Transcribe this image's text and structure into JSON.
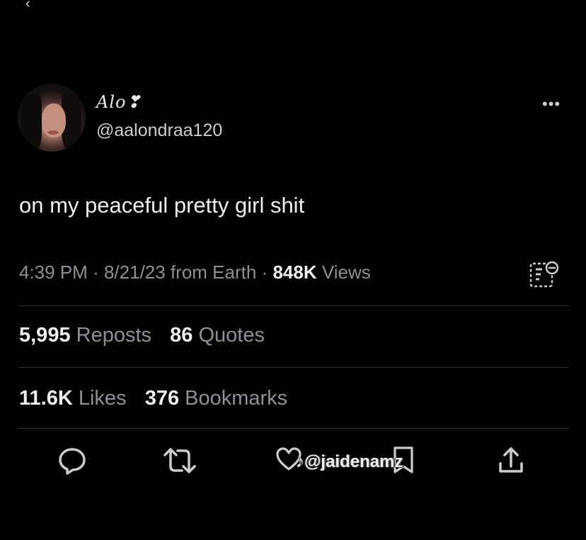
{
  "user": {
    "display_name": "Alo❣",
    "handle": "@aalondraa120"
  },
  "tweet": {
    "text": "on my peaceful pretty girl shit"
  },
  "meta": {
    "time": "4:39 PM",
    "date": "8/21/23",
    "source": "from Earth",
    "views_count": "848K",
    "views_label": "Views",
    "separator": "·"
  },
  "stats": {
    "reposts_count": "5,995",
    "reposts_label": "Reposts",
    "quotes_count": "86",
    "quotes_label": "Quotes",
    "likes_count": "11.6K",
    "likes_label": "Likes",
    "bookmarks_count": "376",
    "bookmarks_label": "Bookmarks"
  },
  "watermark": {
    "text": "@jaidenamz"
  },
  "icons": {
    "back": "back-chevron-icon",
    "more": "more-dots-icon",
    "analytics": "analytics-icon",
    "reply": "reply-icon",
    "repost": "repost-icon",
    "like": "like-icon",
    "bookmark": "bookmark-icon",
    "share": "share-icon",
    "tiktok": "tiktok-icon"
  },
  "colors": {
    "background": "#000000",
    "text_primary": "#eceeef",
    "text_secondary": "#8b9197",
    "divider": "#2c3036"
  }
}
